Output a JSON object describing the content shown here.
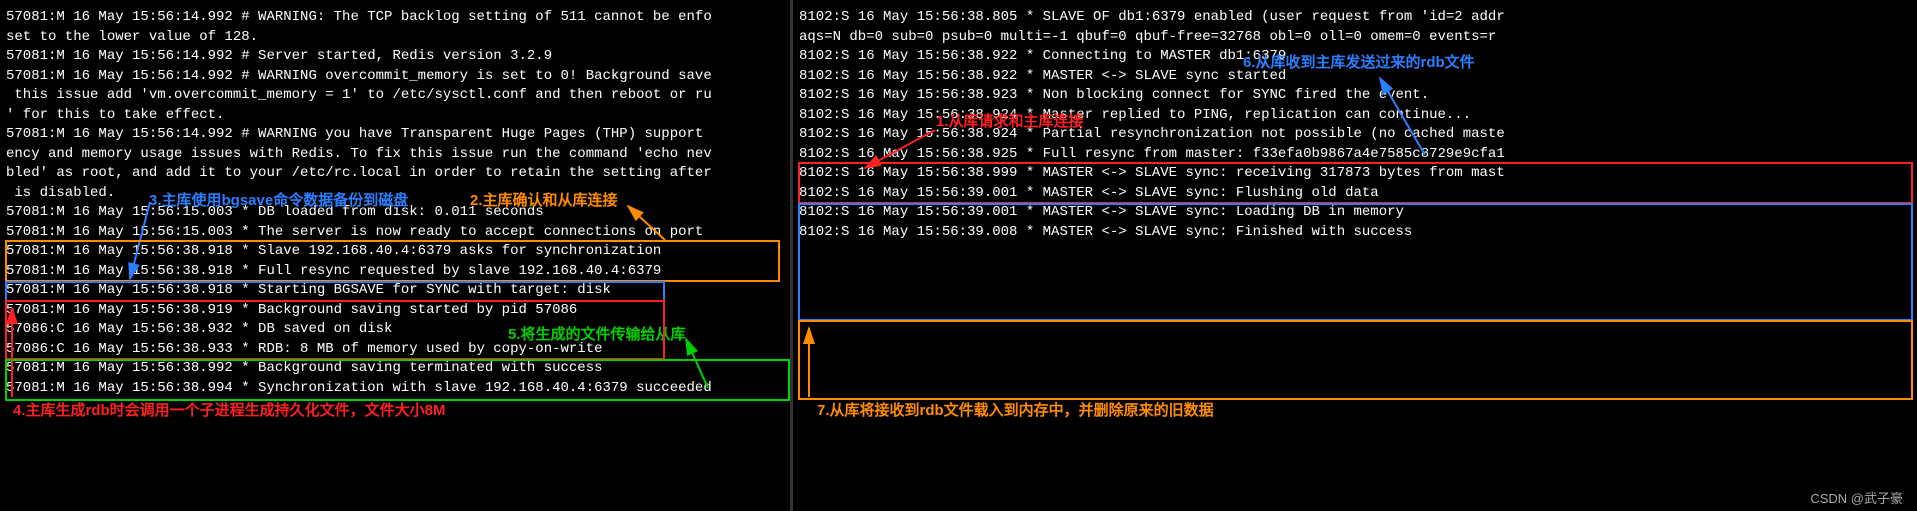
{
  "left_lines": [
    "57081:M 16 May 15:56:14.992 # WARNING: The TCP backlog setting of 511 cannot be enfo",
    "set to the lower value of 128.",
    "57081:M 16 May 15:56:14.992 # Server started, Redis version 3.2.9",
    "57081:M 16 May 15:56:14.992 # WARNING overcommit_memory is set to 0! Background save",
    " this issue add 'vm.overcommit_memory = 1' to /etc/sysctl.conf and then reboot or ru",
    "' for this to take effect.",
    "57081:M 16 May 15:56:14.992 # WARNING you have Transparent Huge Pages (THP) support ",
    "ency and memory usage issues with Redis. To fix this issue run the command 'echo nev",
    "bled' as root, and add it to your /etc/rc.local in order to retain the setting after",
    " is disabled.",
    "57081:M 16 May 15:56:15.003 * DB loaded from disk: 0.011 seconds",
    "57081:M 16 May 15:56:15.003 * The server is now ready to accept connections on port ",
    "57081:M 16 May 15:56:38.918 * Slave 192.168.40.4:6379 asks for synchronization",
    "57081:M 16 May 15:56:38.918 * Full resync requested by slave 192.168.40.4:6379",
    "57081:M 16 May 15:56:38.918 * Starting BGSAVE for SYNC with target: disk",
    "57081:M 16 May 15:56:38.919 * Background saving started by pid 57086",
    "57086:C 16 May 15:56:38.932 * DB saved on disk",
    "57086:C 16 May 15:56:38.933 * RDB: 8 MB of memory used by copy-on-write",
    "57081:M 16 May 15:56:38.992 * Background saving terminated with success",
    "57081:M 16 May 15:56:38.994 * Synchronization with slave 192.168.40.4:6379 succeeded"
  ],
  "right_lines": [
    "",
    "",
    "",
    "",
    "",
    "",
    "",
    "",
    "8102:S 16 May 15:56:38.805 * SLAVE OF db1:6379 enabled (user request from 'id=2 addr",
    "aqs=N db=0 sub=0 psub=0 multi=-1 qbuf=0 qbuf-free=32768 obl=0 oll=0 omem=0 events=r ",
    "8102:S 16 May 15:56:38.922 * Connecting to MASTER db1:6379",
    "8102:S 16 May 15:56:38.922 * MASTER <-> SLAVE sync started",
    "8102:S 16 May 15:56:38.923 * Non blocking connect for SYNC fired the event.",
    "8102:S 16 May 15:56:38.924 * Master replied to PING, replication can continue...",
    "8102:S 16 May 15:56:38.924 * Partial resynchronization not possible (no cached maste",
    "8102:S 16 May 15:56:38.925 * Full resync from master: f33efa0b9867a4e7585c8729e9cfa1",
    "8102:S 16 May 15:56:38.999 * MASTER <-> SLAVE sync: receiving 317873 bytes from mast",
    "8102:S 16 May 15:56:39.001 * MASTER <-> SLAVE sync: Flushing old data",
    "8102:S 16 May 15:56:39.001 * MASTER <-> SLAVE sync: Loading DB in memory",
    "8102:S 16 May 15:56:39.008 * MASTER <-> SLAVE sync: Finished with success"
  ],
  "annotations": {
    "a1": "1.从库请求和主库连接",
    "a2": "2.主库确认和从库连接",
    "a3": "3.主库使用bgsave命令数据备份到磁盘",
    "a4": "4.主库生成rdb时会调用一个子进程生成持久化文件，文件大小8M",
    "a5": "5.将生成的文件传输给从库",
    "a6": "6.从库收到主库发送过来的rdb文件",
    "a7": "7.从库将接收到rdb文件载入到内存中，并删除原来的旧数据"
  },
  "watermark": "CSDN @武子豪"
}
